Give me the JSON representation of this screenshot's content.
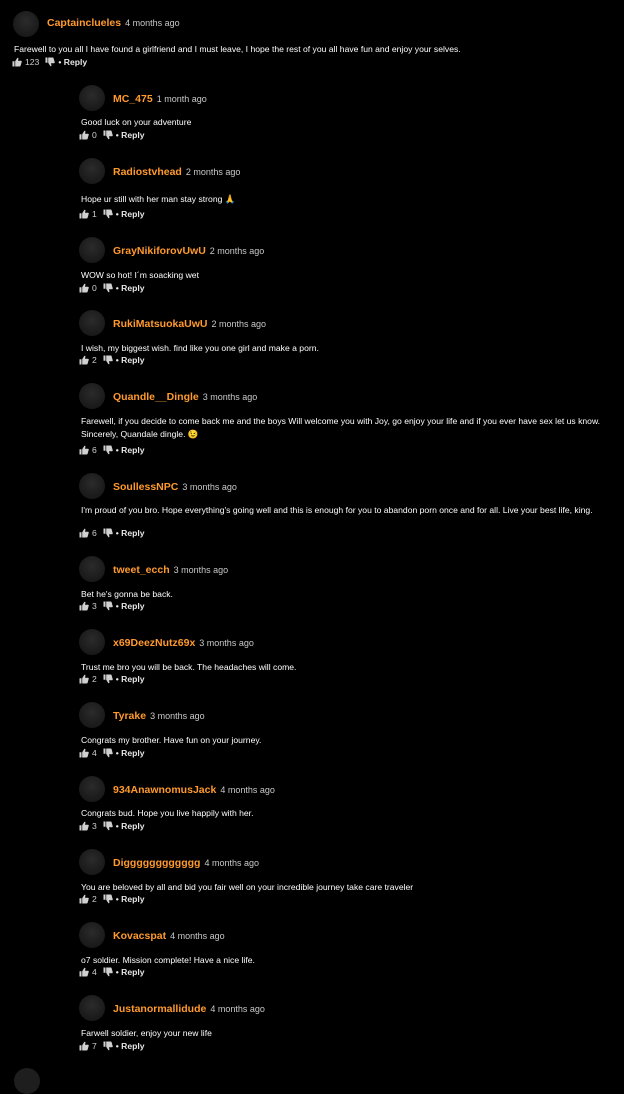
{
  "icons": {
    "like": "thumbs-up-icon",
    "dislike": "thumbs-down-icon"
  },
  "colors": {
    "username": "#ff9a2e",
    "background": "#000000"
  },
  "reply_label": "• Reply",
  "main": {
    "username": "Captainclueles",
    "time": "4 months ago",
    "text": "Farewell to you all I have found a girlfriend and I must leave, I hope the rest of you all have fun and enjoy your selves.",
    "likes": "123"
  },
  "replies": [
    {
      "username": "MC_475",
      "time": "1 month ago",
      "text": "Good luck on your adventure",
      "likes": "0"
    },
    {
      "username": "Radiostvhead",
      "time": "2 months ago",
      "text": "Hope ur still with her man stay strong 🙏",
      "likes": "1"
    },
    {
      "username": "GrayNikiforovUwU",
      "time": "2 months ago",
      "text": "WOW so hot! I´m soacking wet",
      "likes": "0"
    },
    {
      "username": "RukiMatsuokaUwU",
      "time": "2 months ago",
      "text": "I wish, my biggest wish. find like you one girl and make a porn.",
      "likes": "2"
    },
    {
      "username": "Quandle__Dingle",
      "time": "3 months ago",
      "text": "Farewell, if you decide to come back me and the boys Will welcome you with Joy, go enjoy your life and if you ever have sex let us know. Sincerely, Quandale dingle. 😉",
      "likes": "6"
    },
    {
      "username": "SoullessNPC",
      "time": "3 months ago",
      "text": "I'm proud of you bro. Hope everything's going well and this is enough for you to abandon porn once and for all. Live your best life, king.",
      "likes": "6"
    },
    {
      "username": "tweet_ecch",
      "time": "3 months ago",
      "text": "Bet he's gonna be back.",
      "likes": "3"
    },
    {
      "username": "x69DeezNutz69x",
      "time": "3 months ago",
      "text": "Trust me bro you will be back. The headaches will come.",
      "likes": "2"
    },
    {
      "username": "Tyrake",
      "time": "3 months ago",
      "text": "Congrats my brother. Have fun on your journey.",
      "likes": "4"
    },
    {
      "username": "934AnawnomusJack",
      "time": "4 months ago",
      "text": "Congrats bud. Hope you live happily with her.",
      "likes": "3"
    },
    {
      "username": "Digggggggggggg",
      "time": "4 months ago",
      "text": "You are beloved by all and bid you fair well on your incredible journey take care traveler",
      "likes": "2"
    },
    {
      "username": "Kovacspat",
      "time": "4 months ago",
      "text": "o7 soldier. Mission complete! Have a nice life.",
      "likes": "4"
    },
    {
      "username": "Justanormallidude",
      "time": "4 months ago",
      "text": "Farwell soldier, enjoy your new life",
      "likes": "7"
    }
  ]
}
